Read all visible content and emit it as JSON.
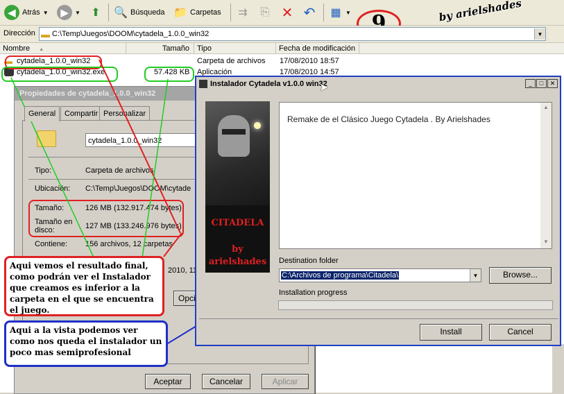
{
  "toolbar": {
    "back_label": "Atrás",
    "search_label": "Búsqueda",
    "folders_label": "Carpetas"
  },
  "address": {
    "label": "Dirección",
    "path": "C:\\Temp\\Juegos\\DOOM\\cytadela_1.0.0_win32"
  },
  "columns": {
    "name": "Nombre",
    "size": "Tamaño",
    "type": "Tipo",
    "modified": "Fecha de modificación"
  },
  "files": [
    {
      "name": "cytadela_1.0.0_win32",
      "size": "",
      "type": "Carpeta de archivos",
      "modified": "17/08/2010 18:57"
    },
    {
      "name": "cytadela_1.0.0_win32.exe",
      "size": "57.428 KB",
      "type": "Aplicación",
      "modified": "17/08/2010 14:57"
    }
  ],
  "properties": {
    "title": "Propiedades de cytadela_1.0.0_win32",
    "tabs": [
      "General",
      "Compartir",
      "Personalizar"
    ],
    "folder_name": "cytadela_1.0.0_win32",
    "type_label": "Tipo:",
    "type_value": "Carpeta de archivos",
    "location_label": "Ubicación:",
    "location_value": "C:\\Temp\\Juegos\\DOOM\\cytade",
    "size_label": "Tamaño:",
    "size_value": "126 MB (132.917.474 bytes)",
    "disk_label": "Tamaño en disco:",
    "disk_value": "127 MB (133.246.976 bytes)",
    "contains_label": "Contiene:",
    "contains_value": "156 archivos, 12 carpetas",
    "created_partial": "2010, 11",
    "options_partial": "Opcio",
    "ok_label": "Aceptar",
    "cancel_label": "Cancelar",
    "apply_label": "Aplicar"
  },
  "installer": {
    "title": "Instalador Cytadela v1.0.0 win32",
    "logo_title": "CITADELA",
    "logo_by": "by",
    "logo_author": "arielshades",
    "description": "Remake de el Clásico Juego Cytadela . By Arielshades",
    "dest_label": "Destination folder",
    "dest_value": "C:\\Archivos de programa\\Citadela\\",
    "browse_label": "Browse...",
    "progress_label": "Installation progress",
    "install_label": "Install",
    "cancel_label": "Cancel",
    "progress": 0
  },
  "annotations": {
    "step_number": "9",
    "watermark": "by arielshades",
    "note_red": "Aqui vemos el resultado final, como podrán ver el Instalador que creamos es inferior a la carpeta en el que se encuentra el juego.",
    "note_blue": "Aqui a la vista podemos ver como nos queda el instalador un poco mas semiprofesional"
  },
  "colors": {
    "red_mark": "#e02020",
    "green_mark": "#22cc22",
    "blue_mark": "#1f2fc8",
    "accent_title": "#0a246a"
  }
}
